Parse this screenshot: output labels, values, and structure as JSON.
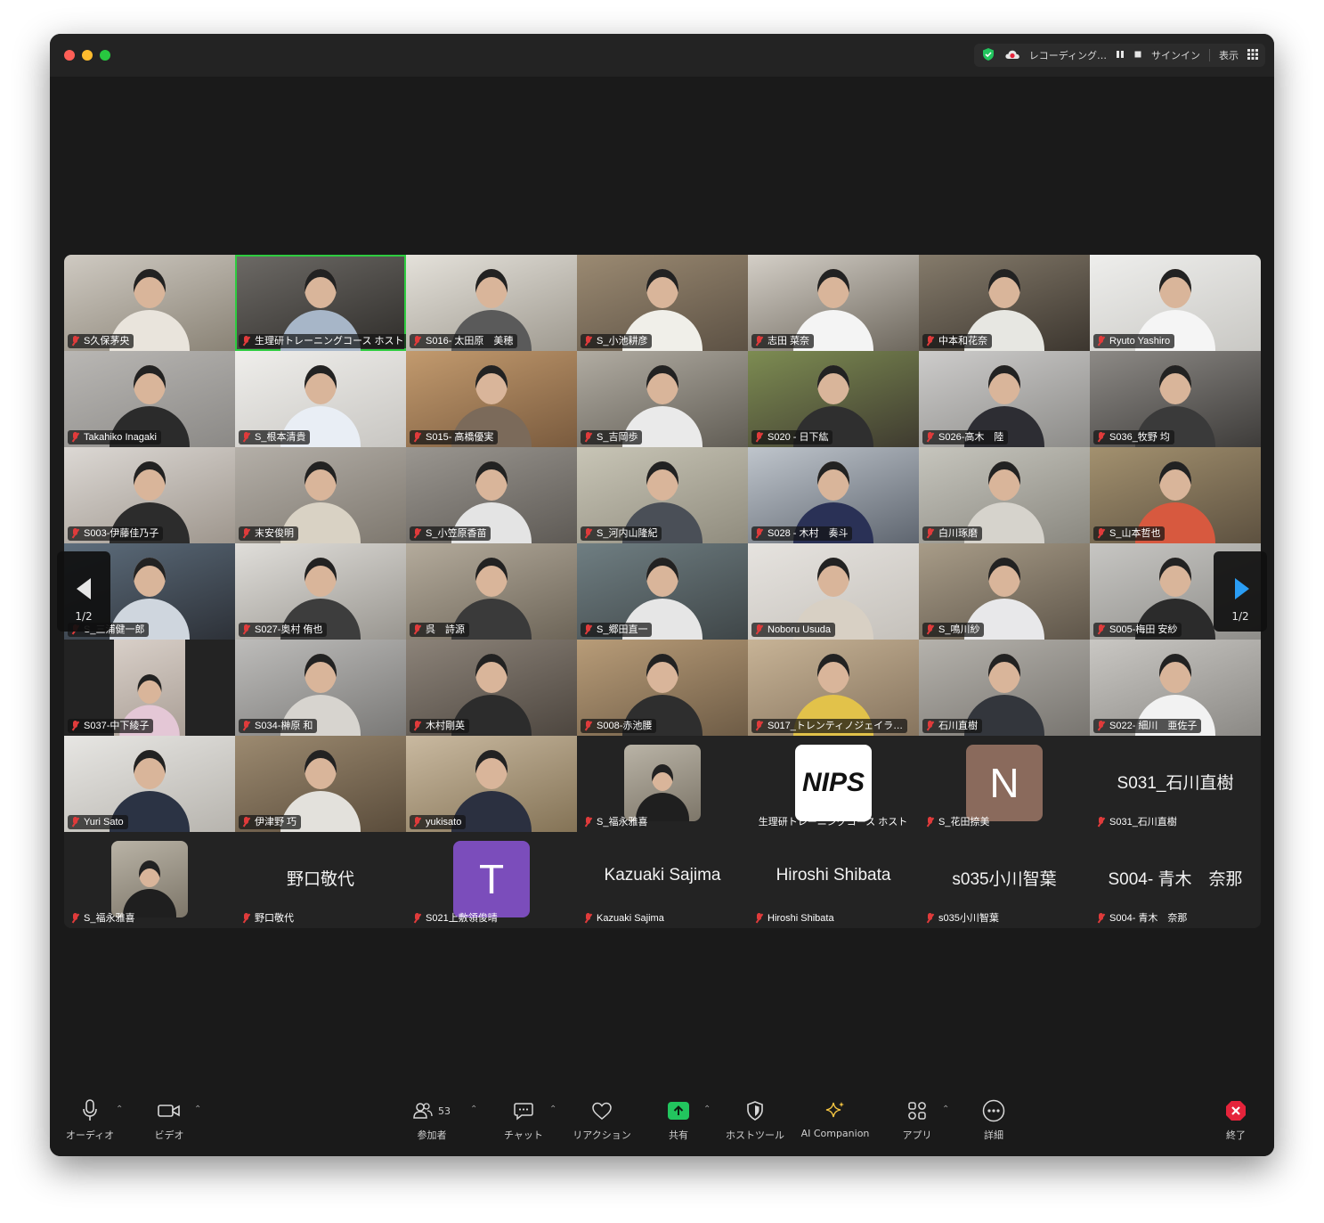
{
  "titlebar": {
    "recording_label": "レコーディング…",
    "signin": "サインイン",
    "view": "表示"
  },
  "tiles": [
    {
      "name": "S久保茅央",
      "type": "photo",
      "c1": "#cfcac2",
      "c2": "#8a8376",
      "shirt": "#e9e4dc"
    },
    {
      "name": "生理研トレーニングコース ホスト",
      "type": "photo",
      "c1": "#6d6a66",
      "c2": "#2f2d2a",
      "shirt": "#a7b6c8",
      "active": true
    },
    {
      "name": "S016- 太田原　美穂",
      "type": "photo",
      "c1": "#e4e1da",
      "c2": "#9f9a90",
      "shirt": "#5a5a5a"
    },
    {
      "name": "S_小池耕彦",
      "type": "photo",
      "c1": "#9b8a72",
      "c2": "#5c5144",
      "shirt": "#f0efe9"
    },
    {
      "name": "志田 菜奈",
      "type": "photo",
      "c1": "#d4cfc7",
      "c2": "#6d675d",
      "shirt": "#f4f4f4"
    },
    {
      "name": "中本和花奈",
      "type": "photo",
      "c1": "#857b6b",
      "c2": "#3c362f",
      "shirt": "#e7e7e2"
    },
    {
      "name": "Ryuto Yashiro",
      "type": "photo",
      "c1": "#eeeeec",
      "c2": "#c9c8c4",
      "shirt": "#f5f5f5"
    },
    {
      "name": "Takahiko Inagaki",
      "type": "photo",
      "c1": "#b9b7b4",
      "c2": "#8b8986",
      "shirt": "#2b2b2b"
    },
    {
      "name": "S_根本清貴",
      "type": "photo",
      "c1": "#efeeeb",
      "c2": "#c8c6c2",
      "shirt": "#e9eef5"
    },
    {
      "name": "S015- 高橋優実",
      "type": "photo",
      "c1": "#c29a6e",
      "c2": "#7a5b3e",
      "shirt": "#7b6a5a"
    },
    {
      "name": "S_吉岡歩",
      "type": "photo",
      "c1": "#b1aca2",
      "c2": "#615d55",
      "shirt": "#eaeaea"
    },
    {
      "name": "S020 - 日下紘",
      "type": "photo",
      "c1": "#7d8c52",
      "c2": "#3f3b30",
      "shirt": "#2f2f2f"
    },
    {
      "name": "S026-高木　陸",
      "type": "photo",
      "c1": "#cdcccb",
      "c2": "#8c8b88",
      "shirt": "#2d2d33"
    },
    {
      "name": "S036_牧野 均",
      "type": "photo",
      "c1": "#8d8a86",
      "c2": "#3e3c3a",
      "shirt": "#3a3a3a"
    },
    {
      "name": "S003-伊藤佳乃子",
      "type": "photo",
      "c1": "#dcd8d4",
      "c2": "#9e968d",
      "shirt": "#2c2c2c"
    },
    {
      "name": "末安俊明",
      "type": "photo",
      "c1": "#b4afa8",
      "c2": "#7e786f",
      "shirt": "#d9d2c4"
    },
    {
      "name": "S_小笠原香苗",
      "type": "photo",
      "c1": "#9a9690",
      "c2": "#5e5a55",
      "shirt": "#e4e4e4"
    },
    {
      "name": "S_河内山隆紀",
      "type": "photo",
      "c1": "#c8c5b6",
      "c2": "#908c7e",
      "shirt": "#4a4f57"
    },
    {
      "name": "S028 - 木村　奏斗",
      "type": "photo",
      "c1": "#bfc5cc",
      "c2": "#5f6670",
      "shirt": "#2a3156"
    },
    {
      "name": "白川琢磨",
      "type": "photo",
      "c1": "#c6c5bd",
      "c2": "#8a8880",
      "shirt": "#d6d3cc"
    },
    {
      "name": "S_山本哲也",
      "type": "photo",
      "c1": "#a3916f",
      "c2": "#5d5140",
      "shirt": "#d7593f"
    },
    {
      "name": "S_三浦健一郎",
      "type": "photo",
      "c1": "#5d6d7c",
      "c2": "#2d3138",
      "shirt": "#cfd6de"
    },
    {
      "name": "S027-奥村 侑也",
      "type": "photo",
      "c1": "#e0deda",
      "c2": "#999690",
      "shirt": "#3d3d3d"
    },
    {
      "name": "呉　詩源",
      "type": "photo",
      "c1": "#b4ab9c",
      "c2": "#6d6558",
      "shirt": "#3a3a3a"
    },
    {
      "name": "S_郷田直一",
      "type": "photo",
      "c1": "#6f7e82",
      "c2": "#3f4648",
      "shirt": "#e6e6e6"
    },
    {
      "name": "Noboru Usuda",
      "type": "photo",
      "c1": "#e6e3df",
      "c2": "#c5c1bb",
      "shirt": "#d8d0c4"
    },
    {
      "name": "S_鳴川紗",
      "type": "photo",
      "c1": "#a89c88",
      "c2": "#5f564a",
      "shirt": "#e8e8ea"
    },
    {
      "name": "S005-梅田 安紗",
      "type": "photo",
      "c1": "#c7c6c3",
      "c2": "#8e8d89",
      "shirt": "#2b2b2b"
    },
    {
      "name": "S037-中下綾子",
      "type": "photo",
      "c1": "#d8cfc8",
      "c2": "#aa9f96",
      "shirt": "#e4c7d6",
      "narrow": true
    },
    {
      "name": "S034-榊原 和",
      "type": "photo",
      "c1": "#bdbcba",
      "c2": "#7a7977",
      "shirt": "#d7d4cf"
    },
    {
      "name": "木村剛英",
      "type": "photo",
      "c1": "#8c8379",
      "c2": "#4d463f",
      "shirt": "#2c2c2c"
    },
    {
      "name": "S008-赤池腰",
      "type": "photo",
      "c1": "#b89c78",
      "c2": "#6e5c46",
      "shirt": "#2e2e2e"
    },
    {
      "name": "S017_トレンティノジェイラ…",
      "type": "photo",
      "c1": "#c7b396",
      "c2": "#86745e",
      "shirt": "#e2c24a"
    },
    {
      "name": "石川直樹",
      "type": "photo",
      "c1": "#b5b2ac",
      "c2": "#787570",
      "shirt": "#33363c"
    },
    {
      "name": "S022- 細川　亜佐子",
      "type": "photo",
      "c1": "#c9c7c3",
      "c2": "#8b8985",
      "shirt": "#f2f2f2"
    },
    {
      "name": "Yuri Sato",
      "type": "photo",
      "c1": "#e7e6e3",
      "c2": "#b7b4ae",
      "shirt": "#2b3344"
    },
    {
      "name": "伊津野 巧",
      "type": "photo",
      "c1": "#9c8a70",
      "c2": "#5a4c3b",
      "shirt": "#e3e1dc"
    },
    {
      "name": "yukisato",
      "type": "photo",
      "c1": "#c9b9a0",
      "c2": "#847356",
      "shirt": "#2b3040"
    },
    {
      "name": "S_福永雅喜",
      "type": "thumb",
      "shirt": "#1f1f1f"
    },
    {
      "name": "生理研トレーニングコース ホスト",
      "type": "logo",
      "logo": "NIPS"
    },
    {
      "name": "S_花田捺美",
      "type": "letter",
      "letter": "N",
      "color": "#8a6a5c"
    },
    {
      "name": "S031_石川直樹",
      "type": "text",
      "display": "S031_石川直樹"
    },
    {
      "name": "S_福永雅喜",
      "type": "thumb",
      "shirt": "#1f1f1f"
    },
    {
      "name": "野口敬代",
      "type": "text",
      "display": "野口敬代"
    },
    {
      "name": "S021上敷領俊晴",
      "type": "letter",
      "letter": "T",
      "color": "#7b4dbb"
    },
    {
      "name": "Kazuaki Sajima",
      "type": "text",
      "display": "Kazuaki Sajima"
    },
    {
      "name": "Hiroshi Shibata",
      "type": "text",
      "display": "Hiroshi Shibata"
    },
    {
      "name": "s035小川智葉",
      "type": "text",
      "display": "s035小川智葉"
    },
    {
      "name": "S004- 青木　奈那",
      "type": "text",
      "display": "S004- 青木　奈那"
    }
  ],
  "pagination": {
    "left": "1/2",
    "right": "1/2"
  },
  "toolbar": {
    "audio": "オーディオ",
    "video": "ビデオ",
    "participants": "参加者",
    "participants_count": "53",
    "chat": "チャット",
    "reactions": "リアクション",
    "share": "共有",
    "host_tools": "ホストツール",
    "ai_companion": "AI Companion",
    "apps": "アプリ",
    "more": "詳細",
    "end": "終了"
  },
  "colors": {
    "share_green": "#22c55e",
    "pager_blue": "#2a9df4",
    "end_red": "#e5243b",
    "ai_gold": "#f5c542"
  }
}
